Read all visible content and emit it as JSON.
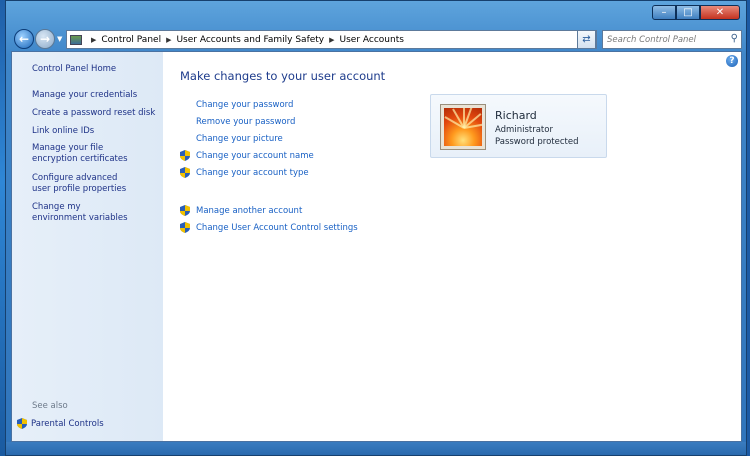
{
  "window": {
    "minimize_icon": "minimize-icon",
    "maximize_icon": "maximize-icon",
    "close_icon": "close-icon"
  },
  "toolbar": {
    "breadcrumbs": [
      "Control Panel",
      "User Accounts and Family Safety",
      "User Accounts"
    ],
    "search_placeholder": "Search Control Panel"
  },
  "sidebar": {
    "home": "Control Panel Home",
    "items": [
      "Manage your credentials",
      "Create a password reset disk",
      "Link online IDs",
      "Manage your file encryption certificates",
      "Configure advanced user profile properties",
      "Change my environment variables"
    ],
    "see_also_label": "See also",
    "parental_controls": "Parental Controls"
  },
  "main": {
    "title": "Make changes to your user account",
    "links": [
      {
        "label": "Change your password",
        "shield": false
      },
      {
        "label": "Remove your password",
        "shield": false
      },
      {
        "label": "Change your picture",
        "shield": false
      },
      {
        "label": "Change your account name",
        "shield": true
      },
      {
        "label": "Change your account type",
        "shield": true
      }
    ],
    "other_links": [
      {
        "label": "Manage another account",
        "shield": true
      },
      {
        "label": "Change User Account Control settings",
        "shield": true
      }
    ]
  },
  "user": {
    "name": "Richard",
    "role": "Administrator",
    "status": "Password protected"
  },
  "colors": {
    "link": "#1860c4",
    "title": "#1e3c8c",
    "sidebar_link": "#1e3287"
  }
}
